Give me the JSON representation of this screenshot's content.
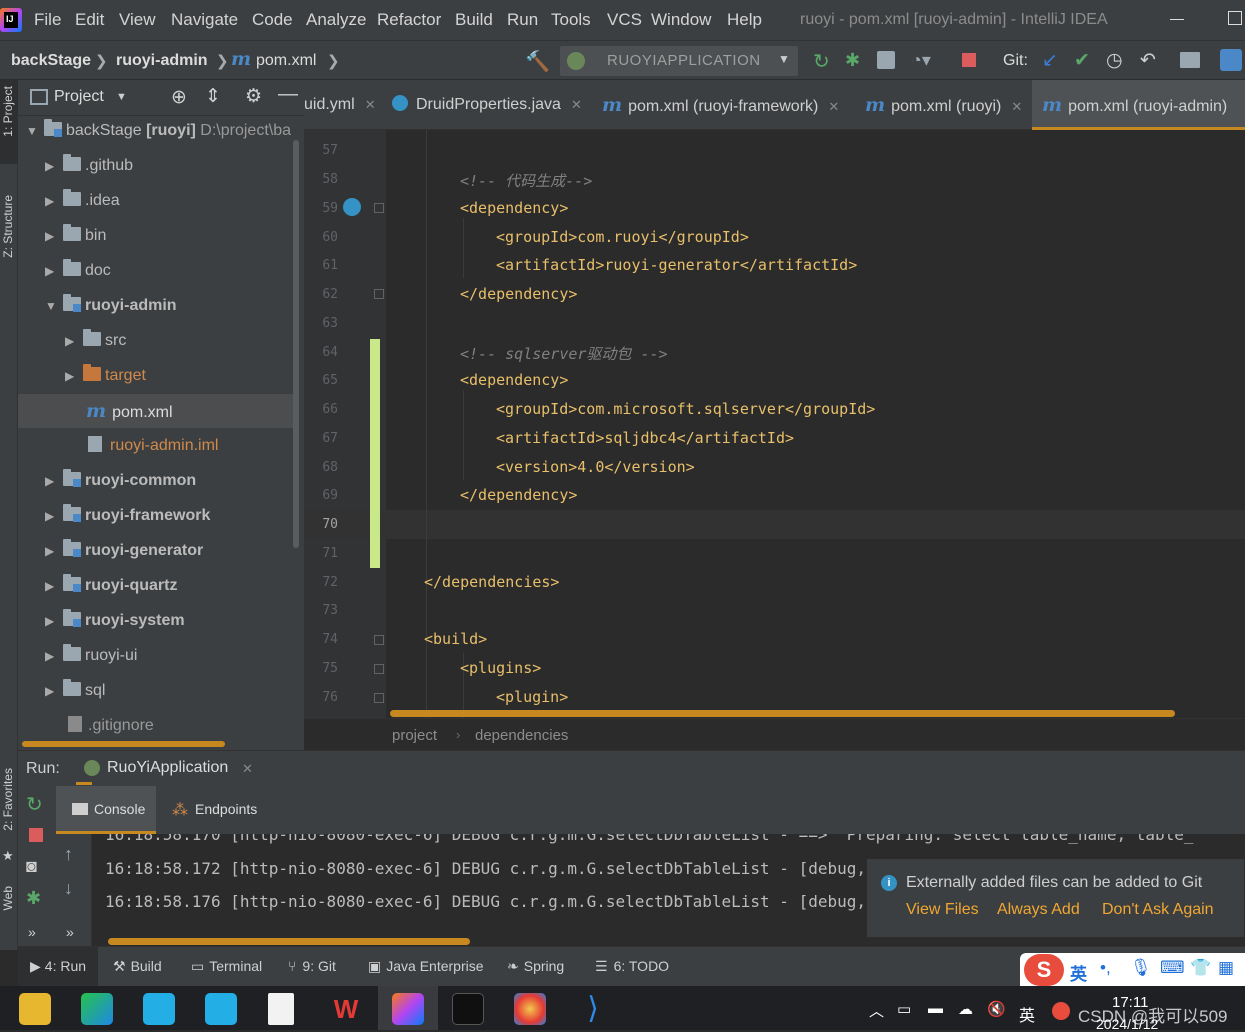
{
  "window": {
    "title": "ruoyi - pom.xml [ruoyi-admin] - IntelliJ IDEA"
  },
  "menu": [
    "File",
    "Edit",
    "View",
    "Navigate",
    "Code",
    "Analyze",
    "Refactor",
    "Build",
    "Run",
    "Tools",
    "VCS",
    "Window",
    "Help"
  ],
  "navbar": {
    "breadcrumb": [
      "backStage",
      "ruoyi-admin",
      "pom.xml"
    ],
    "run_config": "RUOYIAPPLICATION",
    "git_label": "Git:"
  },
  "side_tabs": {
    "project": "1: Project",
    "structure": "Z: Structure",
    "favorites": "2: Favorites",
    "web": "Web"
  },
  "project_panel": {
    "title": "Project",
    "root": {
      "name": "backStage",
      "module": "[ruoyi]",
      "path": "D:\\project\\ba"
    },
    "items": [
      {
        "label": ".github",
        "kind": "folder",
        "state": "collapsed"
      },
      {
        "label": ".idea",
        "kind": "folder",
        "state": "collapsed"
      },
      {
        "label": "bin",
        "kind": "folder",
        "state": "collapsed"
      },
      {
        "label": "doc",
        "kind": "folder",
        "state": "collapsed"
      },
      {
        "label": "ruoyi-admin",
        "kind": "module",
        "state": "expanded"
      },
      {
        "label": "src",
        "kind": "folder",
        "state": "collapsed"
      },
      {
        "label": "target",
        "kind": "folder-orange",
        "state": "collapsed"
      },
      {
        "label": "pom.xml",
        "kind": "maven",
        "state": "selected"
      },
      {
        "label": "ruoyi-admin.iml",
        "kind": "iml",
        "state": "none"
      },
      {
        "label": "ruoyi-common",
        "kind": "module",
        "state": "collapsed"
      },
      {
        "label": "ruoyi-framework",
        "kind": "module",
        "state": "collapsed"
      },
      {
        "label": "ruoyi-generator",
        "kind": "module",
        "state": "collapsed"
      },
      {
        "label": "ruoyi-quartz",
        "kind": "module",
        "state": "collapsed"
      },
      {
        "label": "ruoyi-system",
        "kind": "module",
        "state": "collapsed"
      },
      {
        "label": "ruoyi-ui",
        "kind": "folder",
        "state": "collapsed"
      },
      {
        "label": "sql",
        "kind": "folder",
        "state": "collapsed"
      },
      {
        "label": ".gitignore",
        "kind": "file",
        "state": "none"
      }
    ]
  },
  "editor_tabs": [
    {
      "label": "uid.yml",
      "active": false
    },
    {
      "label": "DruidProperties.java",
      "active": false
    },
    {
      "label": "pom.xml (ruoyi-framework)",
      "active": false
    },
    {
      "label": "pom.xml (ruoyi)",
      "active": false
    },
    {
      "label": "pom.xml (ruoyi-admin)",
      "active": true
    }
  ],
  "code_lines": [
    {
      "n": "57",
      "text": ""
    },
    {
      "n": "58",
      "text": "<!-- 代码生成-->"
    },
    {
      "n": "59",
      "text": "<dependency>"
    },
    {
      "n": "60",
      "text": "<groupId>com.ruoyi</groupId>"
    },
    {
      "n": "61",
      "text": "<artifactId>ruoyi-generator</artifactId>"
    },
    {
      "n": "62",
      "text": "</dependency>"
    },
    {
      "n": "63",
      "text": ""
    },
    {
      "n": "64",
      "text": "<!-- sqlserver驱动包 -->"
    },
    {
      "n": "65",
      "text": "<dependency>"
    },
    {
      "n": "66",
      "text": "<groupId>com.microsoft.sqlserver</groupId>"
    },
    {
      "n": "67",
      "text": "<artifactId>sqljdbc4</artifactId>"
    },
    {
      "n": "68",
      "text": "<version>4.0</version>"
    },
    {
      "n": "69",
      "text": "</dependency>"
    },
    {
      "n": "70",
      "text": ""
    },
    {
      "n": "71",
      "text": ""
    },
    {
      "n": "72",
      "text": "</dependencies>"
    },
    {
      "n": "73",
      "text": ""
    },
    {
      "n": "74",
      "text": "<build>"
    },
    {
      "n": "75",
      "text": "<plugins>"
    },
    {
      "n": "76",
      "text": "<plugin>"
    }
  ],
  "editor_breadcrumb": [
    "project",
    "dependencies"
  ],
  "run": {
    "label": "Run:",
    "config": "RuoYiApplication",
    "tabs": [
      "Console",
      "Endpoints"
    ],
    "log_lines": [
      "16:18:58.170 [http-nio-8080-exec-6] DEBUG c.r.g.m.G.selectDbTableList - ==>  Preparing: select table_name, table_",
      "16:18:58.172 [http-nio-8080-exec-6] DEBUG c.r.g.m.G.selectDbTableList - [debug,135] -",
      "16:18:58.176 [http-nio-8080-exec-6] DEBUG c.r.g.m.G.selectDbTableList - [debug,135] -"
    ]
  },
  "notification": {
    "message": "Externally added files can be added to Git",
    "actions": [
      "View Files",
      "Always Add",
      "Don't Ask Again"
    ]
  },
  "tool_windows": [
    {
      "label": "4: Run",
      "icon": "run-icon"
    },
    {
      "label": "Build",
      "icon": "hammer-icon"
    },
    {
      "label": "Terminal",
      "icon": "terminal-icon"
    },
    {
      "label": "9: Git",
      "icon": "git-branch-icon"
    },
    {
      "label": "Java Enterprise",
      "icon": "java-enterprise-icon"
    },
    {
      "label": "Spring",
      "icon": "spring-icon"
    },
    {
      "label": "6: TODO",
      "icon": "todo-icon"
    }
  ],
  "ime": {
    "lang": "英"
  },
  "taskbar": {
    "time": "17:11",
    "date": "2024/1/12",
    "tray_lang": "英",
    "watermark": "CSDN @我可以509"
  },
  "colors": {
    "accent": "#c7891f",
    "tag": "#e8bf6a",
    "text": "#a9b7c6",
    "comment": "#808080",
    "changed": "#c9e88a",
    "notif_action": "#f0a732"
  }
}
